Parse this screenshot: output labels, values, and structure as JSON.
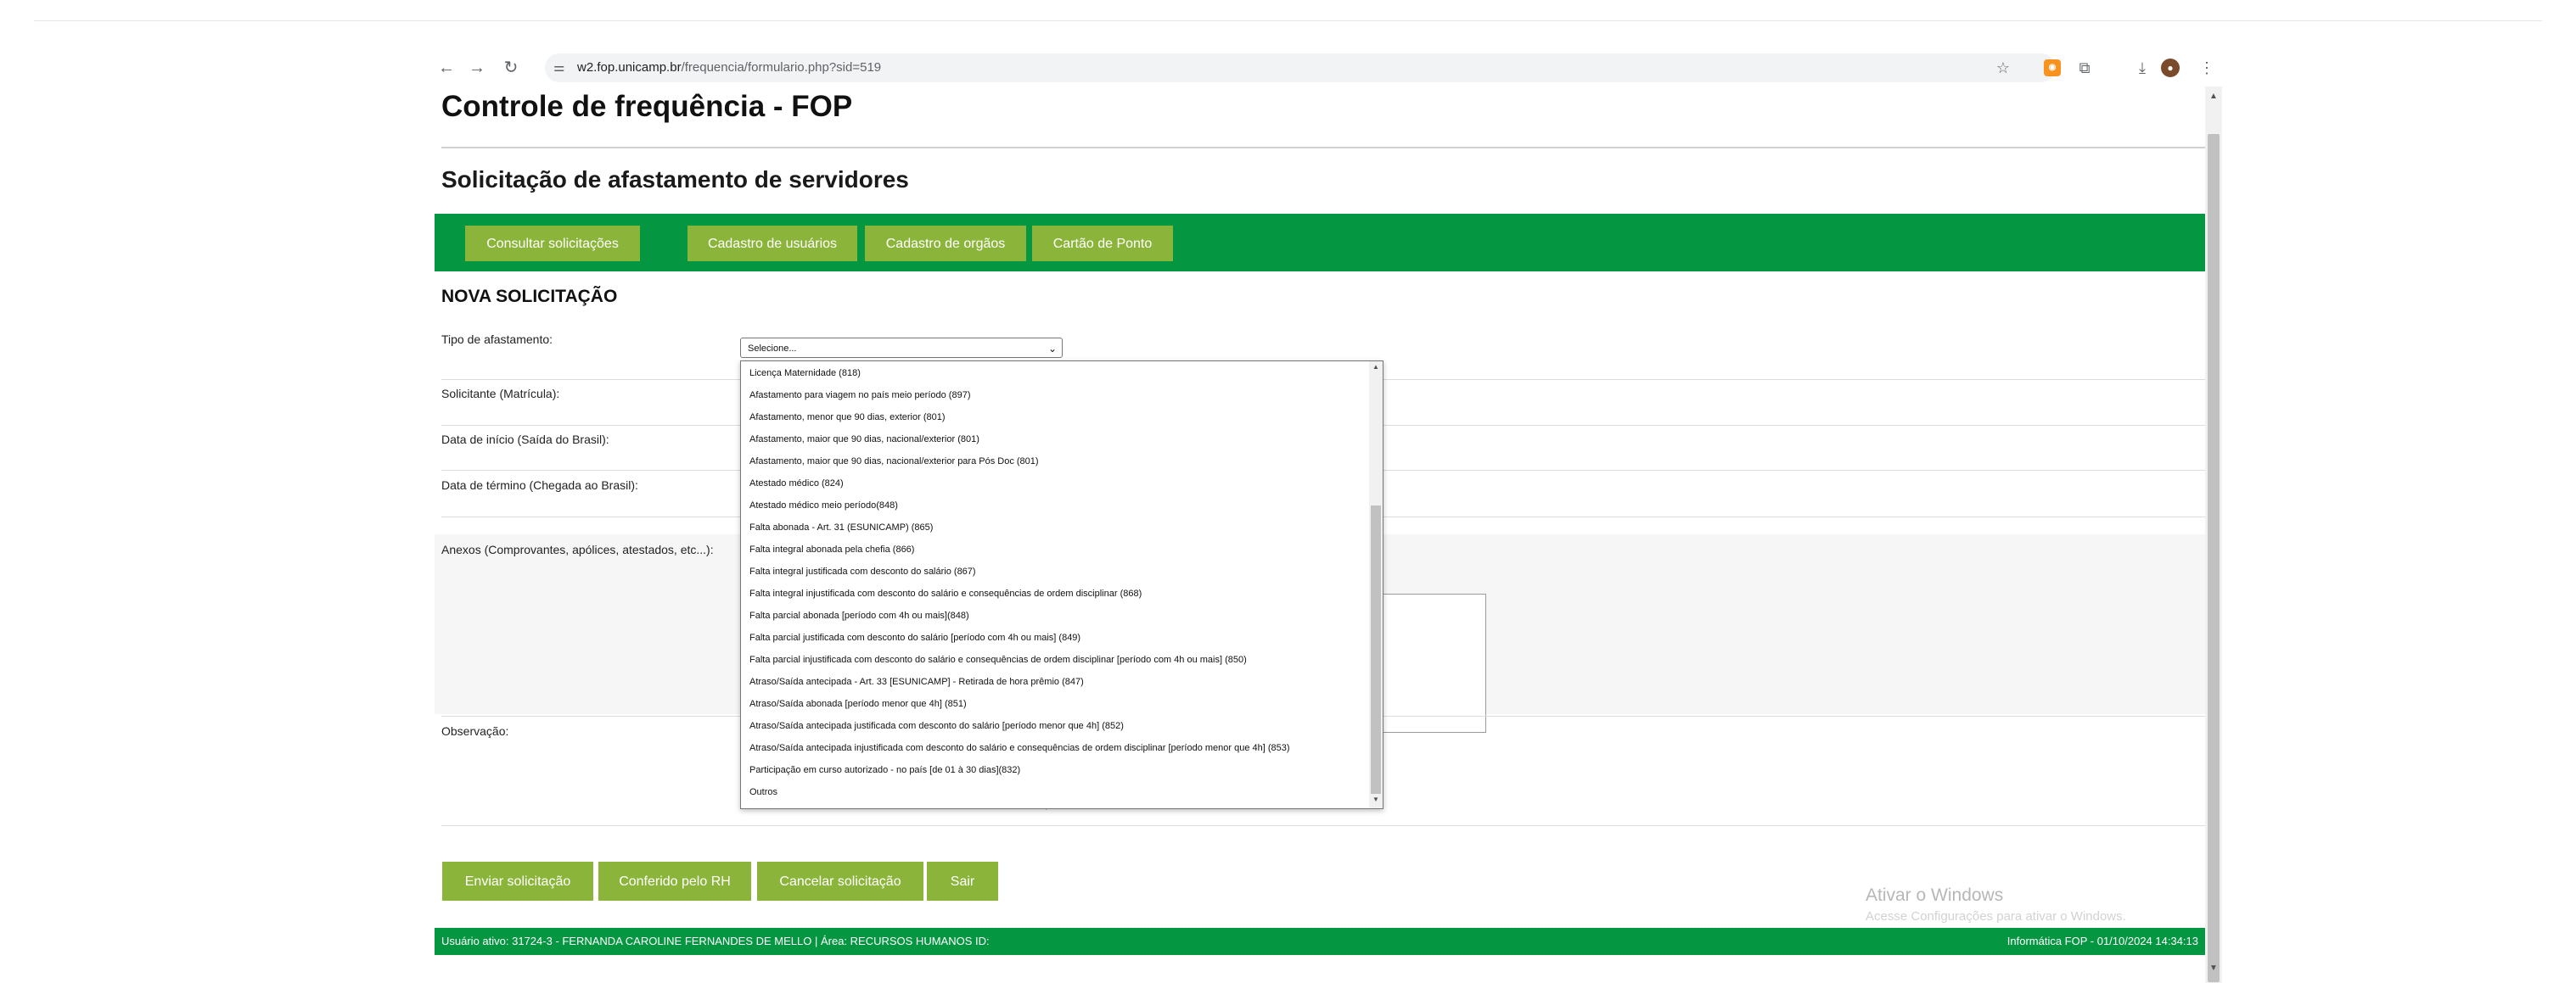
{
  "browser": {
    "url_host": "w2.fop.unicamp.br",
    "url_path": "/frequencia/formulario.php?sid=519",
    "icons": [
      "back-icon",
      "forward-icon",
      "reload-icon",
      "tune-icon",
      "star-icon",
      "extension-icon",
      "puzzle-icon",
      "download-icon",
      "profile-icon",
      "kebab-menu-icon"
    ]
  },
  "page": {
    "title": "Controle de frequência - FOP",
    "subtitle": "Solicitação de afastamento de servidores"
  },
  "menu": [
    {
      "label": "Consultar solicitações"
    },
    {
      "label": "Cadastro de usuários"
    },
    {
      "label": "Cadastro de orgãos"
    },
    {
      "label": "Cartão de Ponto"
    }
  ],
  "form": {
    "section_title": "NOVA SOLICITAÇÃO",
    "fields": {
      "tipo": "Tipo de afastamento:",
      "solicitante": "Solicitante (Matrícula):",
      "inicio": "Data de início (Saída do Brasil):",
      "termino": "Data de término (Chegada ao Brasil):",
      "anexos": "Anexos (Comprovantes, apólices, atestados, etc...):",
      "observacao": "Observação:"
    },
    "select_value": "Selecione...",
    "options": [
      "Licença Maternidade (818)",
      "Afastamento para viagem no país meio período (897)",
      "Afastamento, menor que 90 dias, exterior (801)",
      "Afastamento, maior que 90 dias, nacional/exterior (801)",
      "Afastamento, maior que 90 dias, nacional/exterior para Pós Doc (801)",
      "Atestado médico (824)",
      "Atestado médico meio período(848)",
      "Falta abonada - Art. 31 (ESUNICAMP) (865)",
      "Falta integral abonada pela chefia (866)",
      "Falta integral justificada com desconto do salário (867)",
      "Falta integral injustificada com desconto do salário e consequências de ordem disciplinar (868)",
      "Falta parcial abonada [período com 4h ou mais](848)",
      "Falta parcial justificada com desconto do salário [período com 4h ou mais] (849)",
      "Falta parcial injustificada com desconto do salário e consequências de ordem disciplinar [período com 4h ou mais] (850)",
      "Atraso/Saída antecipada - Art. 33 [ESUNICAMP] - Retirada de hora prêmio (847)",
      "Atraso/Saída abonada [período menor que 4h] (851)",
      "Atraso/Saída antecipada justificada com desconto do salário [período menor que 4h] (852)",
      "Atraso/Saída antecipada injustificada com desconto do salário e consequências de ordem disciplinar [período menor que 4h] (853)",
      "Participação em curso autorizado - no país [de 01 à 30 dias](832)",
      "Outros"
    ]
  },
  "actions": [
    {
      "label": "Enviar solicitação"
    },
    {
      "label": "Conferido pelo RH"
    },
    {
      "label": "Cancelar solicitação"
    },
    {
      "label": "Sair"
    }
  ],
  "watermark": {
    "line1": "Ativar o Windows",
    "line2": "Acesse Configurações para ativar o Windows."
  },
  "footer": {
    "left": "Usuário ativo: 31724-3 - FERNANDA CAROLINE FERNANDES DE MELLO | Área: RECURSOS HUMANOS ID:",
    "right": "Informática FOP - 01/10/2024 14:34:13"
  },
  "colors": {
    "menu_green": "#059641",
    "button_olive": "#8bb53a"
  }
}
